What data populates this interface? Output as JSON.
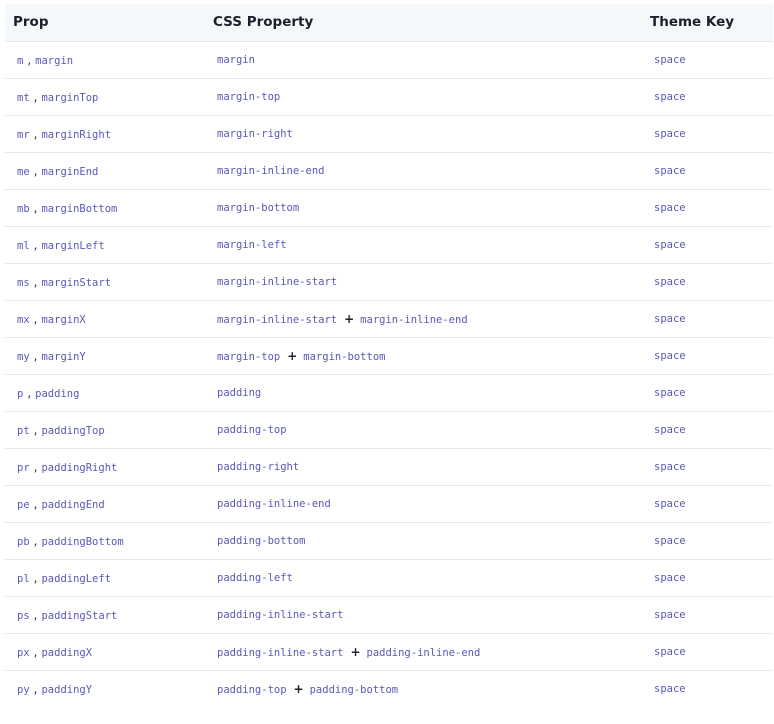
{
  "table": {
    "headers": [
      "Prop",
      "CSS Property",
      "Theme Key"
    ],
    "separator": ",",
    "plus": "+",
    "rows": [
      {
        "short": "m",
        "long": "margin",
        "css": [
          "margin"
        ],
        "key": "space"
      },
      {
        "short": "mt",
        "long": "marginTop",
        "css": [
          "margin-top"
        ],
        "key": "space"
      },
      {
        "short": "mr",
        "long": "marginRight",
        "css": [
          "margin-right"
        ],
        "key": "space"
      },
      {
        "short": "me",
        "long": "marginEnd",
        "css": [
          "margin-inline-end"
        ],
        "key": "space"
      },
      {
        "short": "mb",
        "long": "marginBottom",
        "css": [
          "margin-bottom"
        ],
        "key": "space"
      },
      {
        "short": "ml",
        "long": "marginLeft",
        "css": [
          "margin-left"
        ],
        "key": "space"
      },
      {
        "short": "ms",
        "long": "marginStart",
        "css": [
          "margin-inline-start"
        ],
        "key": "space"
      },
      {
        "short": "mx",
        "long": "marginX",
        "css": [
          "margin-inline-start",
          "margin-inline-end"
        ],
        "key": "space"
      },
      {
        "short": "my",
        "long": "marginY",
        "css": [
          "margin-top",
          "margin-bottom"
        ],
        "key": "space"
      },
      {
        "short": "p",
        "long": "padding",
        "css": [
          "padding"
        ],
        "key": "space"
      },
      {
        "short": "pt",
        "long": "paddingTop",
        "css": [
          "padding-top"
        ],
        "key": "space"
      },
      {
        "short": "pr",
        "long": "paddingRight",
        "css": [
          "padding-right"
        ],
        "key": "space"
      },
      {
        "short": "pe",
        "long": "paddingEnd",
        "css": [
          "padding-inline-end"
        ],
        "key": "space"
      },
      {
        "short": "pb",
        "long": "paddingBottom",
        "css": [
          "padding-bottom"
        ],
        "key": "space"
      },
      {
        "short": "pl",
        "long": "paddingLeft",
        "css": [
          "padding-left"
        ],
        "key": "space"
      },
      {
        "short": "ps",
        "long": "paddingStart",
        "css": [
          "padding-inline-start"
        ],
        "key": "space"
      },
      {
        "short": "px",
        "long": "paddingX",
        "css": [
          "padding-inline-start",
          "padding-inline-end"
        ],
        "key": "space"
      },
      {
        "short": "py",
        "long": "paddingY",
        "css": [
          "padding-top",
          "padding-bottom"
        ],
        "key": "space"
      }
    ]
  }
}
